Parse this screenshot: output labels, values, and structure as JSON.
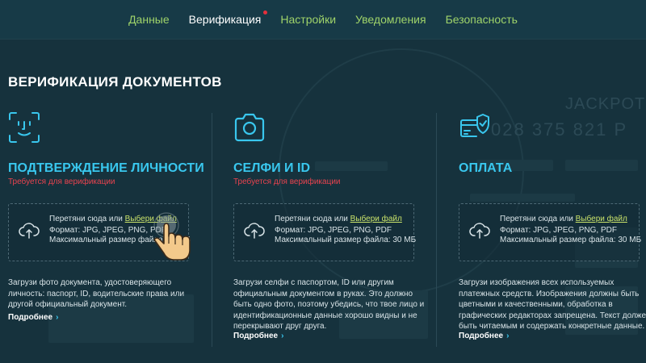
{
  "nav": {
    "tabs": [
      {
        "label": "Данные",
        "active": false
      },
      {
        "label": "Верификация",
        "active": true,
        "has_dot": true
      },
      {
        "label": "Настройки",
        "active": false
      },
      {
        "label": "Уведомления",
        "active": false
      },
      {
        "label": "Безопасность",
        "active": false
      }
    ]
  },
  "background": {
    "jackpot_text": "JACKPOT",
    "jackpot_number": "028 375 821 P"
  },
  "page": {
    "title": "ВЕРИФИКАЦИЯ ДОКУМЕНТОВ"
  },
  "cards": [
    {
      "icon": "face-id-icon",
      "title": "ПОДТВЕРЖДЕНИЕ ЛИЧНОСТИ",
      "required": "Требуется для верификации",
      "drop_text": "Перетяни сюда или ",
      "drop_link": "Выбери файл",
      "formats": "Формат: JPG, JPEG, PNG, PDF",
      "max_size": "Максимальный размер файла: 30 МБ",
      "description": "Загрузи фото документа, удостоверяющего личность: паспорт, ID, водительские права или другой официальный документ.",
      "more": "Подробнее"
    },
    {
      "icon": "camera-icon",
      "title": "СЕЛФИ И ID",
      "required": "Требуется для верификации",
      "drop_text": "Перетяни сюда или ",
      "drop_link": "Выбери файл",
      "formats": "Формат: JPG, JPEG, PNG, PDF",
      "max_size": "Максимальный размер файла: 30 МБ",
      "description": "Загрузи селфи с паспортом, ID или другим официальным документом в руках. Это должно быть одно фото, поэтому убедись, что твое лицо и идентификационные данные хорошо видны и не перекрывают друг друга.",
      "more": "Подробнее"
    },
    {
      "icon": "card-shield-icon",
      "title": "ОПЛАТА",
      "required": "",
      "drop_text": "Перетяни сюда или ",
      "drop_link": "Выбери файл",
      "formats": "Формат: JPG, JPEG, PNG, PDF",
      "max_size": "Максимальный размер файла: 30 МБ",
      "description": "Загрузи изображения всех используемых платежных средств. Изображения должны быть цветными и качественными, обработка в графических редакторах запрещена. Текст должен быть читаемым и содержать конкретные данные.",
      "more": "Подробнее"
    }
  ],
  "colors": {
    "background": "#16323d",
    "accent": "#39c7ee",
    "nav_link": "#9fd36a",
    "required": "#e9434f",
    "file_link": "#c9e26a"
  }
}
